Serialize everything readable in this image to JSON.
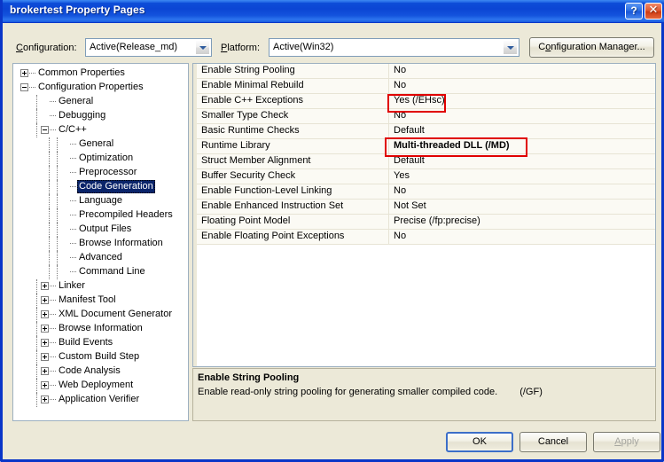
{
  "window": {
    "title": "brokertest Property Pages",
    "help_button": "?",
    "close_button": "✕"
  },
  "config_bar": {
    "configuration_label": "Configuration:",
    "configuration_value": "Active(Release_md)",
    "platform_label": "Platform:",
    "platform_value": "Active(Win32)",
    "configuration_manager_button": "Configuration Manager..."
  },
  "tree": {
    "items": [
      {
        "label": "Common Properties",
        "depth": 0,
        "toggle": "plus"
      },
      {
        "label": "Configuration Properties",
        "depth": 0,
        "toggle": "minus"
      },
      {
        "label": "General",
        "depth": 1,
        "toggle": "none"
      },
      {
        "label": "Debugging",
        "depth": 1,
        "toggle": "none"
      },
      {
        "label": "C/C++",
        "depth": 1,
        "toggle": "minus"
      },
      {
        "label": "General",
        "depth": 2,
        "toggle": "none"
      },
      {
        "label": "Optimization",
        "depth": 2,
        "toggle": "none"
      },
      {
        "label": "Preprocessor",
        "depth": 2,
        "toggle": "none"
      },
      {
        "label": "Code Generation",
        "depth": 2,
        "toggle": "none",
        "selected": true
      },
      {
        "label": "Language",
        "depth": 2,
        "toggle": "none"
      },
      {
        "label": "Precompiled Headers",
        "depth": 2,
        "toggle": "none"
      },
      {
        "label": "Output Files",
        "depth": 2,
        "toggle": "none"
      },
      {
        "label": "Browse Information",
        "depth": 2,
        "toggle": "none"
      },
      {
        "label": "Advanced",
        "depth": 2,
        "toggle": "none"
      },
      {
        "label": "Command Line",
        "depth": 2,
        "toggle": "none"
      },
      {
        "label": "Linker",
        "depth": 1,
        "toggle": "plus"
      },
      {
        "label": "Manifest Tool",
        "depth": 1,
        "toggle": "plus"
      },
      {
        "label": "XML Document Generator",
        "depth": 1,
        "toggle": "plus"
      },
      {
        "label": "Browse Information",
        "depth": 1,
        "toggle": "plus"
      },
      {
        "label": "Build Events",
        "depth": 1,
        "toggle": "plus"
      },
      {
        "label": "Custom Build Step",
        "depth": 1,
        "toggle": "plus"
      },
      {
        "label": "Code Analysis",
        "depth": 1,
        "toggle": "plus"
      },
      {
        "label": "Web Deployment",
        "depth": 1,
        "toggle": "plus"
      },
      {
        "label": "Application Verifier",
        "depth": 1,
        "toggle": "plus"
      }
    ]
  },
  "property_grid": {
    "rows": [
      {
        "name": "Enable String Pooling",
        "value": "No",
        "bold": false
      },
      {
        "name": "Enable Minimal Rebuild",
        "value": "No",
        "bold": false
      },
      {
        "name": "Enable C++ Exceptions",
        "value": "Yes (/EHsc)",
        "bold": false,
        "highlighted": true
      },
      {
        "name": "Smaller Type Check",
        "value": "No",
        "bold": false
      },
      {
        "name": "Basic Runtime Checks",
        "value": "Default",
        "bold": false
      },
      {
        "name": "Runtime Library",
        "value": "Multi-threaded DLL (/MD)",
        "bold": true,
        "highlighted": true
      },
      {
        "name": "Struct Member Alignment",
        "value": "Default",
        "bold": false
      },
      {
        "name": "Buffer Security Check",
        "value": "Yes",
        "bold": false
      },
      {
        "name": "Enable Function-Level Linking",
        "value": "No",
        "bold": false
      },
      {
        "name": "Enable Enhanced Instruction Set",
        "value": "Not Set",
        "bold": false
      },
      {
        "name": "Floating Point Model",
        "value": "Precise (/fp:precise)",
        "bold": false
      },
      {
        "name": "Enable Floating Point Exceptions",
        "value": "No",
        "bold": false
      }
    ]
  },
  "description": {
    "title": "Enable String Pooling",
    "text": "Enable read-only string pooling for generating smaller compiled code.",
    "switch": "(/GF)"
  },
  "footer": {
    "ok_label": "OK",
    "cancel_label": "Cancel",
    "apply_label": "Apply"
  },
  "colors": {
    "titlebar_blue": "#0B45D4",
    "frame_blue": "#0A36C8",
    "dialog_background": "#ECE9D8",
    "selection_blue": "#0A246A",
    "annotation_red": "#E00000"
  }
}
